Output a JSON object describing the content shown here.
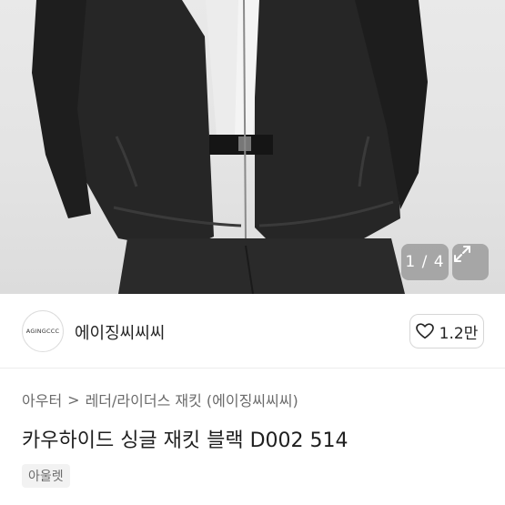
{
  "gallery": {
    "counter": "1 / 4",
    "expand_icon": "expand-arrows-icon"
  },
  "seller": {
    "avatar_text": "AGINGCCC",
    "name": "에이징씨씨씨"
  },
  "like": {
    "icon": "heart-icon",
    "count": "1.2만"
  },
  "breadcrumb": {
    "category": "아우터",
    "separator": ">",
    "subcategory": "레더/라이더스 재킷 (에이징씨씨씨)"
  },
  "product": {
    "title": "카우하이드 싱글 재킷 블랙 D002 514",
    "tag": "아울렛"
  }
}
